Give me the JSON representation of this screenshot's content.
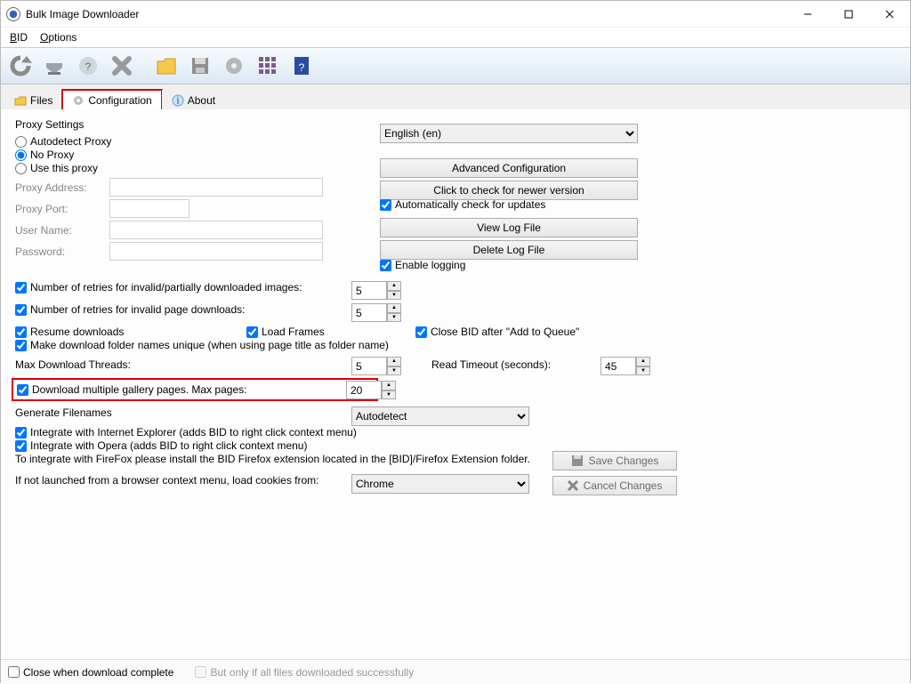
{
  "title": "Bulk Image Downloader",
  "menubar": {
    "bid": "BID",
    "options": "Options"
  },
  "toolbar_icons": [
    "refresh",
    "download",
    "help-sheet",
    "close",
    "folder",
    "save",
    "gear",
    "grid",
    "question"
  ],
  "tabs": {
    "files": "Files",
    "configuration": "Configuration",
    "about": "About"
  },
  "proxy": {
    "legend": "Proxy Settings",
    "autodetect": "Autodetect Proxy",
    "noproxy": "No Proxy",
    "usethis": "Use this proxy",
    "addr_label": "Proxy Address:",
    "port_label": "Proxy Port:",
    "user_label": "User Name:",
    "pass_label": "Password:",
    "addr": "",
    "port": "",
    "user": "",
    "pass": ""
  },
  "language": "English (en)",
  "buttons": {
    "advconf": "Advanced Configuration",
    "checkver": "Click to check for newer version",
    "viewlog": "View Log File",
    "dellog": "Delete Log File",
    "save": "Save Changes",
    "cancel": "Cancel Changes"
  },
  "checks": {
    "auto_upd": "Automatically check for updates",
    "enable_log": "Enable logging",
    "retries_invalid": "Number of retries for invalid/partially downloaded images:",
    "retries_page": "Number of retries for invalid page downloads:",
    "resume": "Resume downloads",
    "load_frames": "Load Frames",
    "close_bid": "Close BID after \"Add to Queue\"",
    "unique": "Make download folder names unique (when using page title as folder name)",
    "multi": "Download multiple gallery pages. Max pages:",
    "int_ie": "Integrate with Internet Explorer (adds BID to right click context menu)",
    "int_op": "Integrate with Opera (adds BID to right click context menu)",
    "close_complete": "Close when download complete",
    "only_if_all": "But only if all files downloaded successfully"
  },
  "labels": {
    "threads": "Max Download Threads:",
    "readto": "Read Timeout (seconds):",
    "genfn": "Generate Filenames",
    "fftxt": "To integrate with FireFox please install the BID Firefox extension located in the [BID]/Firefox Extension folder.",
    "cookies": "If not launched from a browser context menu, load cookies from:"
  },
  "values": {
    "retries_invalid": "5",
    "retries_page": "5",
    "threads": "5",
    "multi_pages": "20",
    "readto": "45",
    "genfn": "Autodetect",
    "cookies": "Chrome"
  }
}
